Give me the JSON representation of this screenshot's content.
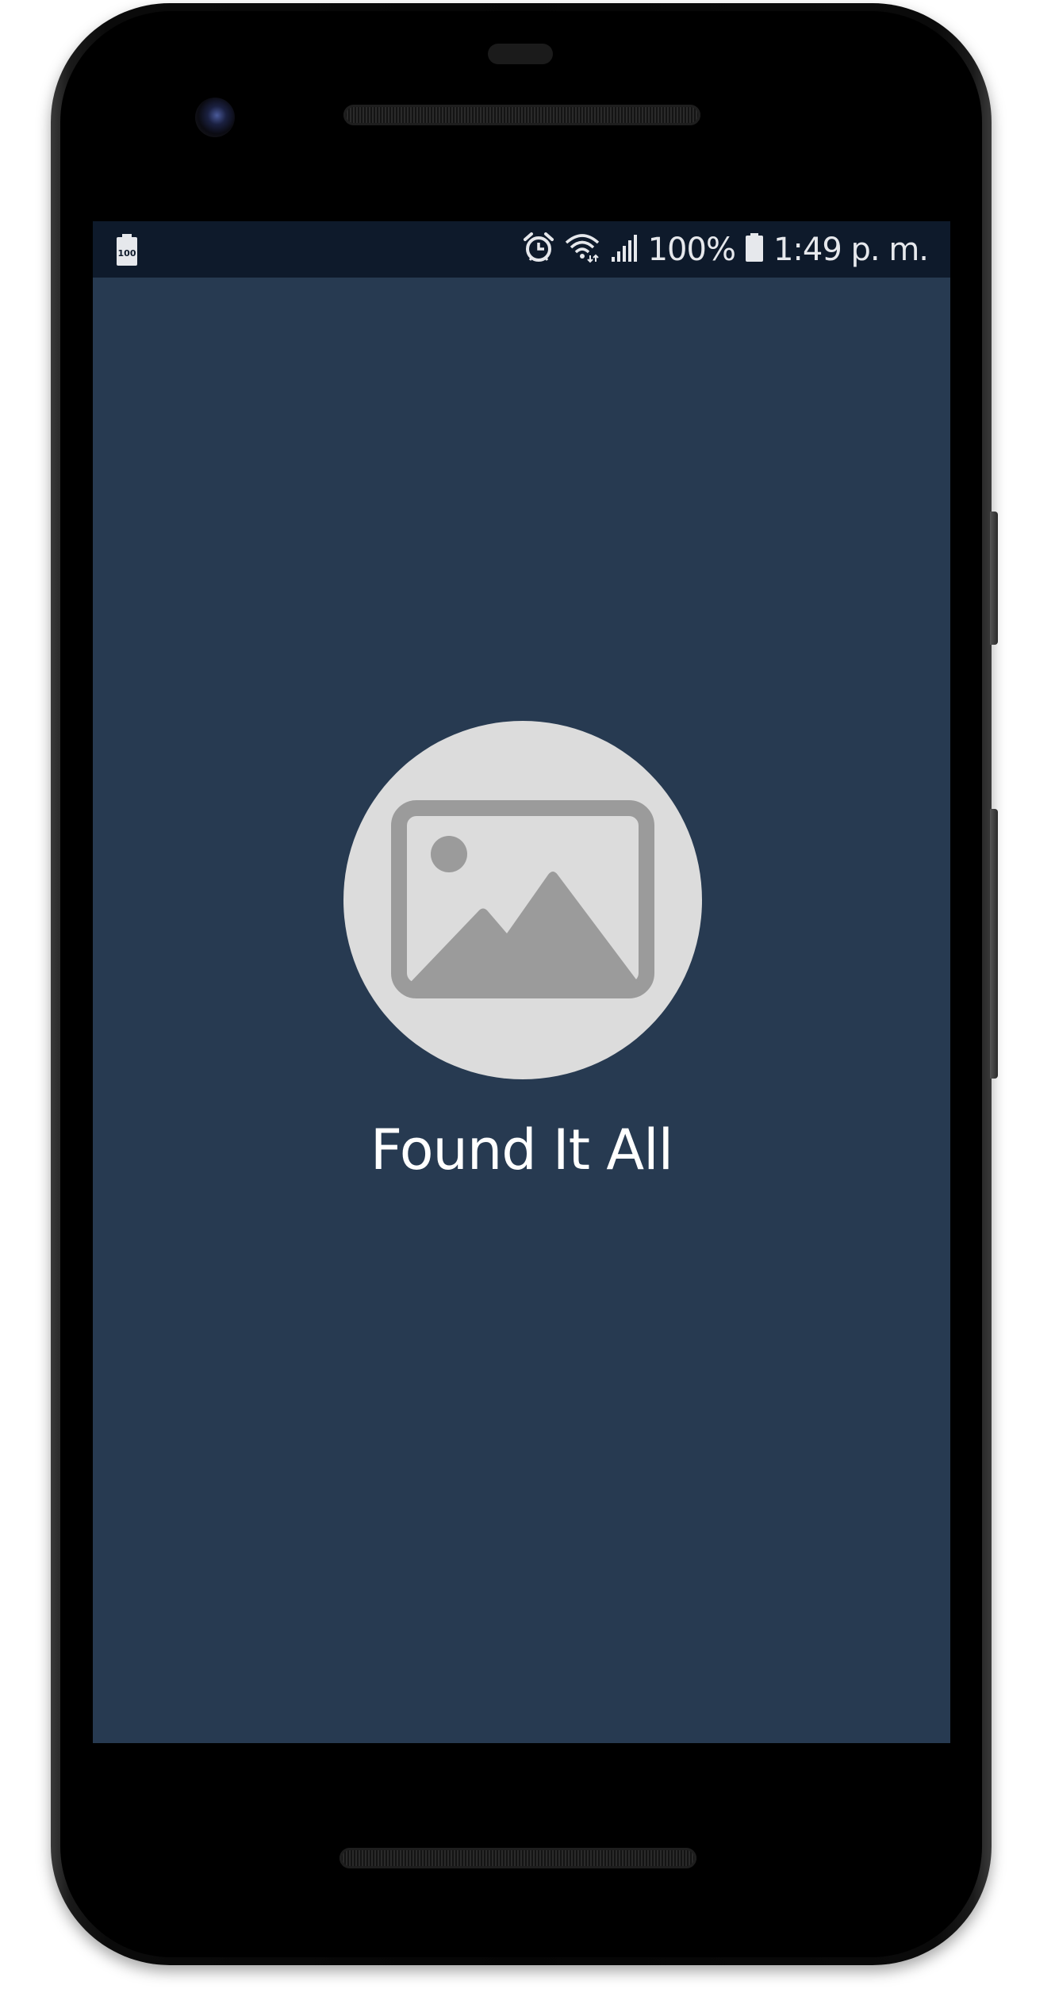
{
  "status_bar": {
    "left_icon": "battery-100-notification-icon",
    "left_icon_text": "100",
    "icons": [
      "alarm-icon",
      "wifi-icon",
      "cellular-signal-icon",
      "battery-icon"
    ],
    "battery_percent": "100%",
    "time": "1:49 p. m."
  },
  "splash": {
    "logo_icon": "image-placeholder-icon",
    "app_name": "Found It All"
  },
  "colors": {
    "screen_background": "#273a51",
    "status_bar_background": "#0e1a2b",
    "logo_circle": "#dcdcdc",
    "logo_glyph": "#9b9b9b",
    "title_text": "#ffffff"
  }
}
